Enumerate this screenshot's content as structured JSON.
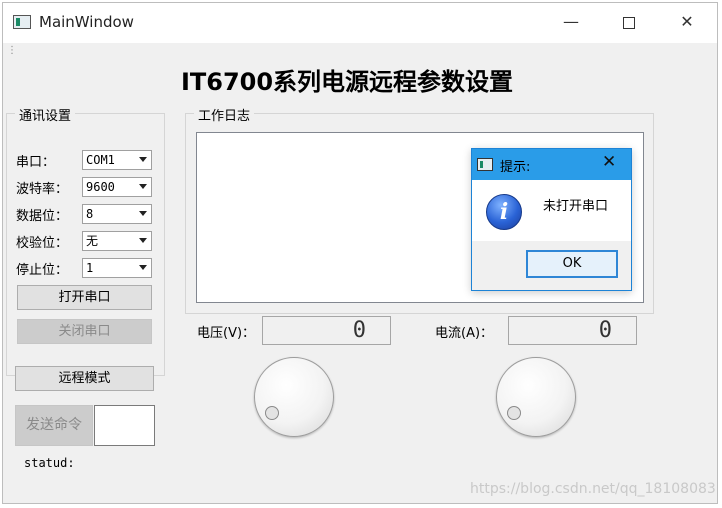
{
  "window": {
    "title": "MainWindow",
    "minimize_glyph": "—",
    "close_glyph": "✕",
    "grip": "⋮"
  },
  "main_title": "IT6700系列电源远程参数设置",
  "comm": {
    "group_label": "通讯设置",
    "port_label": "串口：",
    "port_value": "COM1",
    "baud_label": "波特率：",
    "baud_value": "9600",
    "databits_label": "数据位：",
    "databits_value": "8",
    "parity_label": "校验位：",
    "parity_value": "无",
    "stopbits_label": "停止位：",
    "stopbits_value": "1",
    "open_button": "打开串口",
    "close_button": "关闭串口"
  },
  "remote_mode_button": "远程模式",
  "send_button": "发送命令",
  "status_label": "statud:",
  "log": {
    "group_label": "工作日志"
  },
  "voltage": {
    "label": "电压(V)：",
    "value": "0"
  },
  "current": {
    "label": "电流(A)：",
    "value": "0"
  },
  "dialog": {
    "title": "提示:",
    "close_glyph": "✕",
    "info_glyph": "i",
    "message": "未打开串口",
    "ok_button": "OK"
  },
  "watermark": "https://blog.csdn.net/qq_18108083",
  "colors": {
    "dialog_title_bg": "#2a9ce8",
    "dialog_border": "#1d83d6",
    "window_bg": "#f0f0f0"
  }
}
